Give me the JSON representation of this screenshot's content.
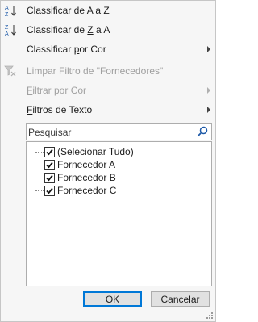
{
  "menu": {
    "sort_az": {
      "pre": "",
      "accel": "",
      "label": "Classificar de A a Z",
      "icon": "sort-a-z-icon"
    },
    "sort_za_pre": "Classificar de ",
    "sort_za_accel": "Z",
    "sort_za_post": " a A",
    "sort_color_pre": "Classificar ",
    "sort_color_accel": "p",
    "sort_color_post": "or Cor",
    "clear_filter_label": "Limpar Filtro de \"Fornecedores\"",
    "filter_color_accel": "F",
    "filter_color_post": "iltrar por Cor",
    "text_filters_accel": "F",
    "text_filters_post": "iltros de Texto"
  },
  "search": {
    "placeholder": "Pesquisar"
  },
  "list": {
    "items": [
      {
        "label": "(Selecionar Tudo)",
        "checked": true
      },
      {
        "label": "Fornecedor A",
        "checked": true
      },
      {
        "label": "Fornecedor B",
        "checked": true
      },
      {
        "label": "Fornecedor C",
        "checked": true
      }
    ]
  },
  "buttons": {
    "ok": "OK",
    "cancel": "Cancelar"
  },
  "colors": {
    "accent": "#0078d7",
    "icon_blue": "#1e5aa8",
    "disabled": "#a0a0a0"
  }
}
